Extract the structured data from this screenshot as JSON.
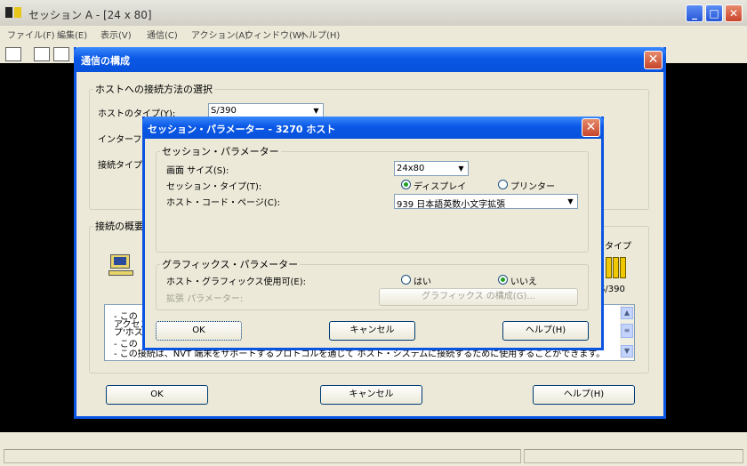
{
  "main": {
    "title": "セッション A - [24 x 80]",
    "menus": [
      "ファイル(F)",
      "編集(E)",
      "表示(V)",
      "通信(C)",
      "アクション(A)",
      "ウィンドウ(W)",
      "ヘルプ(H)"
    ],
    "controls": {
      "minimize": "_",
      "maximize": "□",
      "close": "✕"
    }
  },
  "config_dialog": {
    "title": "通信の構成",
    "close": "✕",
    "host_group": {
      "legend": "ホストへの接続方法の選択",
      "host_type_label": "ホストのタイプ(Y):",
      "host_type_value": "S/390",
      "interface_label": "インターフェース",
      "connection_type_label": "接続タイプ"
    },
    "summary_group": {
      "legend": "接続の概要",
      "type_label": "タイプ",
      "host_caption": "S/390"
    },
    "description_lines": [
      "- この",
      "アクセス",
      "プ'ホス",
      "- この",
      "- この接続は、NVT 端末をサポートするプロトコルを通じて ホスト・システムに接続するために使用することができます。"
    ],
    "scroll": {
      "up": "▲",
      "down": "▼",
      "thumb": "≡"
    },
    "buttons": {
      "ok": "OK",
      "cancel": "キャンセル",
      "help": "ヘルプ(H)"
    }
  },
  "session_dialog": {
    "title": "セッション・パラメーター - 3270 ホスト",
    "close": "✕",
    "session_group": {
      "legend": "セッション・パラメーター",
      "screen_size_label": "画面 サイズ(S):",
      "screen_size_value": "24x80",
      "session_type_label": "セッション・タイプ(T):",
      "display_option": "ディスプレイ",
      "printer_option": "プリンター",
      "selected_session_type": "display",
      "code_page_label": "ホスト・コード・ページ(C):",
      "code_page_value": "939 日本語英数小文字拡張"
    },
    "graphics_group": {
      "legend": "グラフィックス・パラメーター",
      "host_graphics_label": "ホスト・グラフィックス使用可(E):",
      "yes_option": "はい",
      "no_option": "いいえ",
      "selected_graphics": "no",
      "ext_params_label": "拡張 パラメーター:",
      "configure_button": "グラフィックス の構成(G)..."
    },
    "buttons": {
      "ok": "OK",
      "cancel": "キャンセル",
      "help": "ヘルプ(H)"
    },
    "combo_arrow": "▼"
  },
  "colors": {
    "title_bar": "#0a58e6",
    "terminal_bg": "#000000",
    "dialog_bg": "#ece9d8",
    "close_button": "#c8452c",
    "radio_dot": "#21a121"
  }
}
